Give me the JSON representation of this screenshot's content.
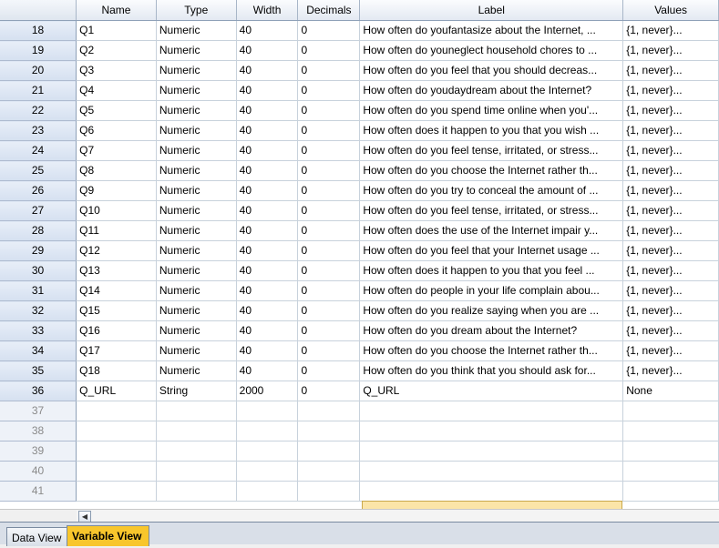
{
  "columns": [
    "Name",
    "Type",
    "Width",
    "Decimals",
    "Label",
    "Values"
  ],
  "rows": [
    {
      "num": "18",
      "name": "Q1",
      "type": "Numeric",
      "width": "40",
      "decimals": "0",
      "label": "How often do youfantasize about the Internet, ...",
      "values": "{1, never}..."
    },
    {
      "num": "19",
      "name": "Q2",
      "type": "Numeric",
      "width": "40",
      "decimals": "0",
      "label": "How often do youneglect household chores to ...",
      "values": "{1, never}..."
    },
    {
      "num": "20",
      "name": "Q3",
      "type": "Numeric",
      "width": "40",
      "decimals": "0",
      "label": "How often do you feel that you should decreas...",
      "values": "{1, never}..."
    },
    {
      "num": "21",
      "name": "Q4",
      "type": "Numeric",
      "width": "40",
      "decimals": "0",
      "label": "How often do youdaydream about the Internet?",
      "values": "{1, never}..."
    },
    {
      "num": "22",
      "name": "Q5",
      "type": "Numeric",
      "width": "40",
      "decimals": "0",
      "label": "How often do you spend time online when you'...",
      "values": "{1, never}..."
    },
    {
      "num": "23",
      "name": "Q6",
      "type": "Numeric",
      "width": "40",
      "decimals": "0",
      "label": "How often does it happen to you that you wish ...",
      "values": "{1, never}..."
    },
    {
      "num": "24",
      "name": "Q7",
      "type": "Numeric",
      "width": "40",
      "decimals": "0",
      "label": "How often do you feel tense, irritated, or stress...",
      "values": "{1, never}..."
    },
    {
      "num": "25",
      "name": "Q8",
      "type": "Numeric",
      "width": "40",
      "decimals": "0",
      "label": "How often do you choose the Internet rather th...",
      "values": "{1, never}..."
    },
    {
      "num": "26",
      "name": "Q9",
      "type": "Numeric",
      "width": "40",
      "decimals": "0",
      "label": "How often do you try to conceal the amount of ...",
      "values": "{1, never}..."
    },
    {
      "num": "27",
      "name": "Q10",
      "type": "Numeric",
      "width": "40",
      "decimals": "0",
      "label": "How often do you feel tense, irritated, or stress...",
      "values": "{1, never}..."
    },
    {
      "num": "28",
      "name": "Q11",
      "type": "Numeric",
      "width": "40",
      "decimals": "0",
      "label": "How often does the use of the Internet impair y...",
      "values": "{1, never}..."
    },
    {
      "num": "29",
      "name": "Q12",
      "type": "Numeric",
      "width": "40",
      "decimals": "0",
      "label": "How often do you feel that your Internet usage ...",
      "values": "{1, never}..."
    },
    {
      "num": "30",
      "name": "Q13",
      "type": "Numeric",
      "width": "40",
      "decimals": "0",
      "label": "How often does it happen to you that you feel ...",
      "values": "{1, never}..."
    },
    {
      "num": "31",
      "name": "Q14",
      "type": "Numeric",
      "width": "40",
      "decimals": "0",
      "label": "How often do people in your life complain abou...",
      "values": "{1, never}..."
    },
    {
      "num": "32",
      "name": "Q15",
      "type": "Numeric",
      "width": "40",
      "decimals": "0",
      "label": "How often do you realize saying when you are ...",
      "values": "{1, never}..."
    },
    {
      "num": "33",
      "name": "Q16",
      "type": "Numeric",
      "width": "40",
      "decimals": "0",
      "label": "How often do you dream about the Internet?",
      "values": "{1, never}..."
    },
    {
      "num": "34",
      "name": "Q17",
      "type": "Numeric",
      "width": "40",
      "decimals": "0",
      "label": "How often do you choose the Internet rather th...",
      "values": "{1, never}..."
    },
    {
      "num": "35",
      "name": "Q18",
      "type": "Numeric",
      "width": "40",
      "decimals": "0",
      "label": "How often do you think that you should ask for...",
      "values": "{1, never}..."
    },
    {
      "num": "36",
      "name": "Q_URL",
      "type": "String",
      "width": "2000",
      "decimals": "0",
      "label": "Q_URL",
      "values": "None"
    }
  ],
  "empty_rows": [
    "37",
    "38",
    "39",
    "40",
    "41"
  ],
  "tabs": {
    "data_view": "Data View",
    "variable_view": "Variable View"
  },
  "colors": {
    "active_tab": "#f8c62c",
    "row_header": "#d5e0f0",
    "selected_cell": "#fbe5a8"
  }
}
